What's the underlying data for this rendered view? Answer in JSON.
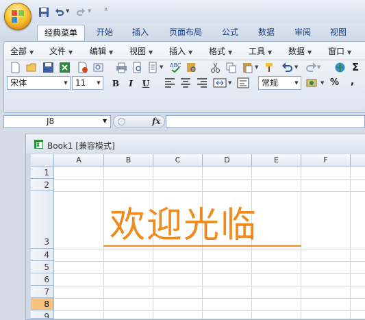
{
  "quick_access": {
    "save_icon": "save-icon",
    "undo_icon": "undo-icon",
    "redo_icon": "redo-icon",
    "customize_icon": "customize-qat-icon"
  },
  "tabs": [
    "经典菜单",
    "开始",
    "插入",
    "页面布局",
    "公式",
    "数据",
    "审阅",
    "视图"
  ],
  "active_tab": "经典菜单",
  "menu": [
    "全部",
    "文件",
    "编辑",
    "视图",
    "插入",
    "格式",
    "工具",
    "数据",
    "窗口"
  ],
  "font": {
    "name": "宋体",
    "size": "11"
  },
  "format_buttons": {
    "bold": "B",
    "italic": "I",
    "underline": "U"
  },
  "number_format": "常规",
  "percent": "%",
  "comma": ",",
  "sigma": "Σ",
  "name_box": "J8",
  "fx_label": "fx",
  "workbook_title": "Book1  [兼容模式]",
  "columns": [
    "A",
    "B",
    "C",
    "D",
    "E",
    "F"
  ],
  "rows": [
    "1",
    "2",
    "3",
    "4",
    "5",
    "6",
    "7",
    "8",
    "9"
  ],
  "selected_row": "8",
  "cell_text": "欢迎光临",
  "colors": {
    "accent": "#f08a1c",
    "selected_header": "#f7c27d",
    "tab_text": "#15428b"
  }
}
